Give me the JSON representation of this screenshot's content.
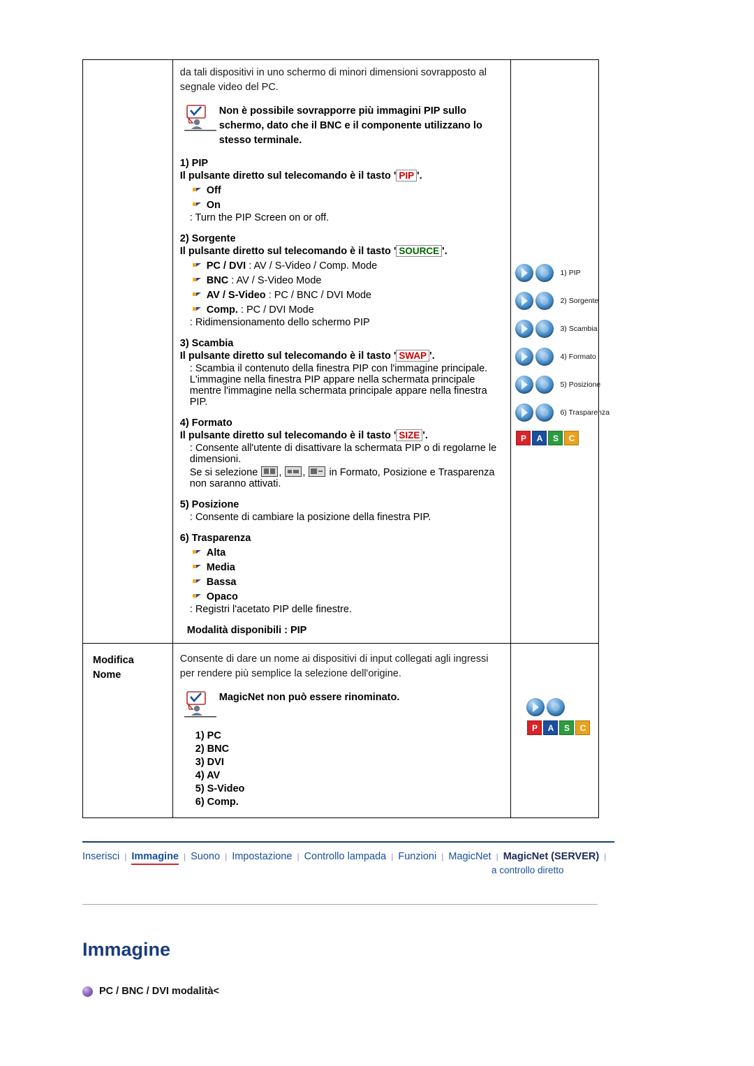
{
  "table": {
    "row1": {
      "label": "",
      "intro": "da tali dispositivi in uno schermo di minori dimensioni sovrapposto al segnale video del PC.",
      "note": "Non è possibile sovrapporre più immagini PIP sullo schermo, dato che il BNC e il componente utilizzano lo stesso terminale.",
      "s1": {
        "head": "1) PIP",
        "direct_pre": "Il pulsante diretto sul telecomando è il tasto '",
        "direct_key": "PIP",
        "direct_post": "'.",
        "bullets": [
          "Off",
          "On"
        ],
        "desc": ": Turn the PIP Screen on or off."
      },
      "s2": {
        "head": "2) Sorgente",
        "direct_pre": "Il pulsante diretto sul telecomando è il tasto '",
        "direct_key": "SOURCE",
        "direct_post": "'.",
        "bullets": [
          {
            "b": "PC / DVI",
            "t": " : AV / S-Video / Comp. Mode"
          },
          {
            "b": "BNC",
            "t": " : AV / S-Video Mode"
          },
          {
            "b": "AV / S-Video",
            "t": " : PC / BNC / DVI Mode"
          },
          {
            "b": "Comp.",
            "t": " : PC / DVI Mode"
          }
        ],
        "desc": ": Ridimensionamento dello schermo PIP"
      },
      "s3": {
        "head": "3) Scambia",
        "direct_pre": "Il pulsante diretto sul telecomando è il tasto '",
        "direct_key": "SWAP",
        "direct_post": "'.",
        "desc": ": Scambia il contenuto della finestra PIP con l'immagine principale. L'immagine nella finestra PIP appare nella schermata principale mentre l'immagine nella schermata principale appare nella finestra PIP."
      },
      "s4": {
        "head": "4) Formato",
        "direct_pre": "Il pulsante diretto sul telecomando è il tasto '",
        "direct_key": "SIZE",
        "direct_post": "'.",
        "desc1": ": Consente all'utente di disattivare la schermata PIP o di regolarne le dimensioni.",
        "desc2_pre": "Se si selezione",
        "desc2_post": "in Formato, Posizione e Trasparenza non saranno attivati."
      },
      "s5": {
        "head": "5) Posizione",
        "desc": ": Consente di cambiare la posizione della finestra PIP."
      },
      "s6": {
        "head": "6) Trasparenza",
        "bullets": [
          "Alta",
          "Media",
          "Bassa",
          "Opaco"
        ],
        "desc": ": Registri l'acetato PIP delle finestre."
      },
      "modes": "Modalità disponibili : PIP",
      "osd_items": [
        "1) PIP",
        "2) Sorgente",
        "3) Scambia",
        "4) Formato",
        "5) Posizione",
        "6) Trasparenza"
      ],
      "pasc": [
        "P",
        "A",
        "S",
        "C"
      ]
    },
    "row2": {
      "label_line1": "Modifica",
      "label_line2": "Nome",
      "intro": "Consente di dare un nome ai dispositivi di input collegati agli ingressi per rendere più semplice la selezione dell'origine.",
      "note": "MagicNet non può essere rinominato.",
      "items": [
        "1) PC",
        "2) BNC",
        "3) DVI",
        "4) AV",
        "5) S-Video",
        "6) Comp."
      ],
      "pasc": [
        "P",
        "A",
        "S",
        "C"
      ]
    }
  },
  "nav": {
    "items": [
      {
        "label": "Inserisci",
        "state": "link"
      },
      {
        "label": "Immagine",
        "state": "active"
      },
      {
        "label": "Suono",
        "state": "link"
      },
      {
        "label": "Impostazione",
        "state": "link"
      },
      {
        "label": "Controllo lampada",
        "state": "link"
      },
      {
        "label": "Funzioni",
        "state": "link"
      },
      {
        "label": "MagicNet",
        "state": "link"
      },
      {
        "label": "MagicNet (SERVER)",
        "state": "dark"
      }
    ],
    "sub": "a controllo diretto"
  },
  "page": {
    "title": "Immagine",
    "subhead": "PC / BNC / DVI modalità<"
  }
}
